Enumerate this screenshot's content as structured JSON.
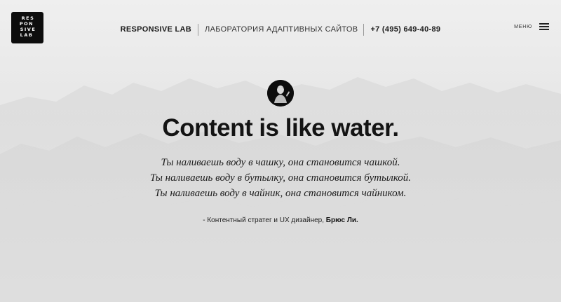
{
  "logo": {
    "rows": [
      "RES",
      "PON",
      "SIVE",
      "LAB"
    ]
  },
  "header": {
    "brand": "RESPONSIVE LAB",
    "tagline": "ЛАБОРАТОРИЯ АДАПТИВНЫХ САЙТОВ",
    "phone": "+7 (495) 649-40-89",
    "menu_label": "МЕНЮ"
  },
  "hero": {
    "headline": "Content is like water.",
    "quote_lines": [
      "Ты наливаешь воду в чашку, она становится чашкой.",
      "Ты наливаешь воду в бутылку, она становится бутылкой.",
      "Ты наливаешь воду в чайник, она становится чайником."
    ],
    "attribution_prefix": "- Контентный стратег и UX дизайнер,",
    "attribution_name": "Брюс Ли."
  },
  "colors": {
    "background": "#e9e9e9",
    "text": "#141414",
    "logo_bg": "#0d0d0d"
  },
  "icons": {
    "menu": "hamburger-icon",
    "avatar": "avatar-icon"
  }
}
